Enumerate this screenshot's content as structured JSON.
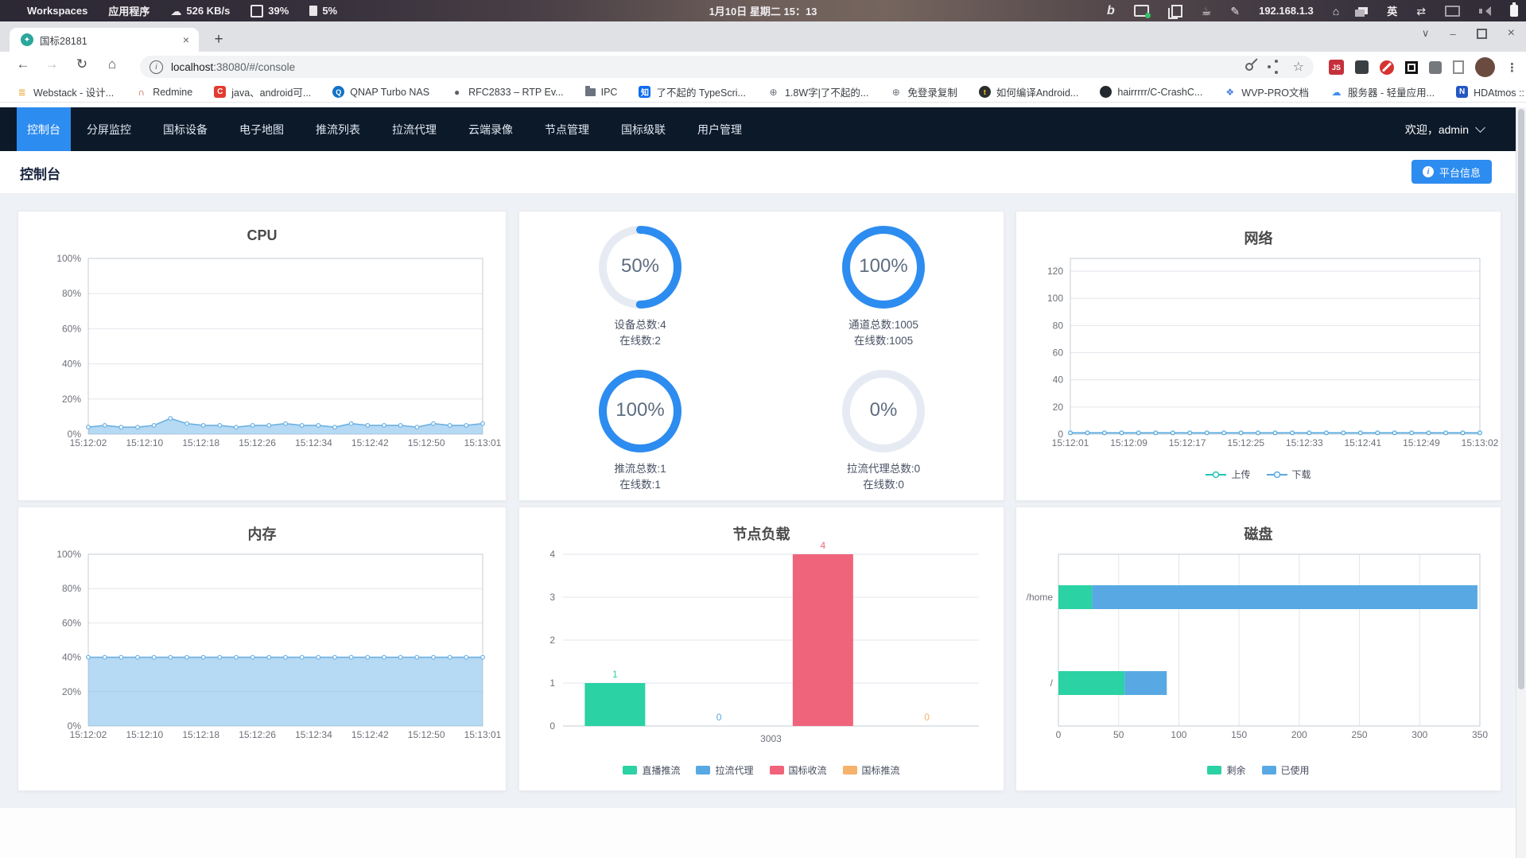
{
  "system_bar": {
    "workspaces": "Workspaces",
    "applications": "应用程序",
    "network_speed": "526 KB/s",
    "cpu": "39%",
    "memory": "5%",
    "clock": "1月10日 星期二 15：13",
    "ip": "192.168.1.3",
    "language": "英",
    "bing": "b"
  },
  "browser": {
    "tab_title": "国标28181",
    "url_host": "localhost",
    "url_path": ":38080/#/console",
    "js_badge": "JS"
  },
  "bookmarks": [
    {
      "label": "Webstack - 设计...",
      "icon": "webstack-icon",
      "style": "plain",
      "glyph": "≣",
      "color": "#e8a838"
    },
    {
      "label": "Redmine",
      "icon": "redmine-icon",
      "style": "plain",
      "glyph": "∩",
      "color": "#c7402f"
    },
    {
      "label": "java、android可...",
      "icon": "csdn-icon",
      "style": "badge",
      "glyph": "C",
      "color": "#ffffff",
      "bg": "#e23c32"
    },
    {
      "label": "QNAP Turbo NAS",
      "icon": "qnap-icon",
      "style": "circle",
      "glyph": "Q",
      "color": "#ffffff",
      "bg": "#1272c8"
    },
    {
      "label": "RFC2833 – RTP Ev...",
      "icon": "rfc-icon",
      "style": "plain",
      "glyph": "●",
      "color": "#5b5f66"
    },
    {
      "label": "IPC",
      "icon": "folder-icon",
      "style": "folder"
    },
    {
      "label": "了不起的 TypeScri...",
      "icon": "zhihu-icon",
      "style": "badge",
      "glyph": "知",
      "color": "#ffffff",
      "bg": "#0c6cf2"
    },
    {
      "label": "1.8W字|了不起的...",
      "icon": "globe-icon",
      "style": "plain",
      "glyph": "⊕",
      "color": "#6a6f77"
    },
    {
      "label": "免登录复制",
      "icon": "globe-icon",
      "style": "plain",
      "glyph": "⊕",
      "color": "#6a6f77"
    },
    {
      "label": "如何编译Android...",
      "icon": "penguin-icon",
      "style": "circle",
      "glyph": "t",
      "color": "#f4c20d",
      "bg": "#2b2d30"
    },
    {
      "label": "hairrrrr/C-CrashC...",
      "icon": "github-icon",
      "style": "circle",
      "glyph": "",
      "color": "#ffffff",
      "bg": "#24292f"
    },
    {
      "label": "WVP-PRO文档",
      "icon": "wvp-icon",
      "style": "plain",
      "glyph": "❖",
      "color": "#4a7fe0"
    },
    {
      "label": "服务器 - 轻量应用...",
      "icon": "cloud-icon",
      "style": "plain",
      "glyph": "☁",
      "color": "#3f8cf3"
    },
    {
      "label": "HDAtmos :: 种子 *...",
      "icon": "hdatmos-icon",
      "style": "badge",
      "glyph": "N",
      "color": "#ffffff",
      "bg": "#2456c4"
    }
  ],
  "bookmarks_overflow": "»",
  "navbar": {
    "items": [
      "控制台",
      "分屏监控",
      "国标设备",
      "电子地图",
      "推流列表",
      "拉流代理",
      "云端录像",
      "节点管理",
      "国标级联",
      "用户管理"
    ],
    "active_index": 0,
    "welcome": "欢迎，admin"
  },
  "page_header": {
    "title": "控制台",
    "platform_info_button": "平台信息"
  },
  "colors": {
    "accent_blue": "#2d8cf0",
    "gauge_track": "#e6ebf3",
    "teal": "#2bd2a4",
    "series_blue": "#58a9e3",
    "red": "#f0647b",
    "orange": "#f6b26b",
    "navbar_bg": "#0c1929"
  },
  "gauges": [
    {
      "percent": "50%",
      "value": 50,
      "line1": "设备总数:4",
      "line2": "在线数:2"
    },
    {
      "percent": "100%",
      "value": 100,
      "line1": "通道总数:1005",
      "line2": "在线数:1005"
    },
    {
      "percent": "100%",
      "value": 100,
      "line1": "推流总数:1",
      "line2": "在线数:1"
    },
    {
      "percent": "0%",
      "value": 0,
      "line1": "拉流代理总数:0",
      "line2": "在线数:0"
    }
  ],
  "chart_data": {
    "cpu": {
      "type": "area",
      "title": "CPU",
      "y_ticks": [
        "100%",
        "80%",
        "60%",
        "40%",
        "20%",
        "0%"
      ],
      "y_max": 100,
      "x_labels": [
        "15:12:02",
        "15:12:10",
        "15:12:18",
        "15:12:26",
        "15:12:34",
        "15:12:42",
        "15:12:50",
        "15:13:01"
      ],
      "series": [
        {
          "name": "cpu",
          "color": "#6cb1e1",
          "fill": "rgba(122,186,235,0.55)",
          "values": [
            4,
            5,
            4,
            4,
            5,
            9,
            6,
            5,
            5,
            4,
            5,
            5,
            6,
            5,
            5,
            4,
            6,
            5,
            5,
            5,
            4,
            6,
            5,
            5,
            6
          ]
        }
      ]
    },
    "memory": {
      "type": "area",
      "title": "内存",
      "y_ticks": [
        "100%",
        "80%",
        "60%",
        "40%",
        "20%",
        "0%"
      ],
      "y_max": 100,
      "x_labels": [
        "15:12:02",
        "15:12:10",
        "15:12:18",
        "15:12:26",
        "15:12:34",
        "15:12:42",
        "15:12:50",
        "15:13:01"
      ],
      "series": [
        {
          "name": "memory",
          "color": "#6cb1e1",
          "fill": "rgba(122,186,235,0.55)",
          "values": [
            40,
            40,
            40,
            40,
            40,
            40,
            40,
            40,
            40,
            40,
            40,
            40,
            40,
            40,
            40,
            40,
            40,
            40,
            40,
            40,
            40,
            40,
            40,
            40,
            40
          ]
        }
      ]
    },
    "network": {
      "type": "line",
      "title": "网络",
      "y_ticks": [
        "120",
        "100",
        "80",
        "60",
        "40",
        "20",
        "0"
      ],
      "y_max": 120,
      "x_labels": [
        "15:12:01",
        "15:12:09",
        "15:12:17",
        "15:12:25",
        "15:12:33",
        "15:12:41",
        "15:12:49",
        "15:13:02"
      ],
      "legend": [
        "上传",
        "下载"
      ],
      "series": [
        {
          "name": "上传",
          "color": "#22c5b6",
          "values": [
            1,
            1,
            1,
            1,
            1,
            1,
            1,
            1,
            1,
            1,
            1,
            1,
            1,
            1,
            1,
            1,
            1,
            1,
            1,
            1,
            1,
            1,
            1,
            1,
            1
          ]
        },
        {
          "name": "下载",
          "color": "#58a9e3",
          "values": [
            1,
            1,
            1,
            1,
            1,
            1,
            1,
            1,
            1,
            1,
            1,
            1,
            1,
            1,
            1,
            1,
            1,
            1,
            1,
            1,
            1,
            1,
            1,
            1,
            1
          ]
        }
      ]
    },
    "node_load": {
      "type": "bar",
      "title": "节点负载",
      "y_ticks": [
        4,
        3,
        2,
        1,
        0
      ],
      "y_max": 4,
      "categories": [
        "直播推流",
        "拉流代理",
        "国标收流",
        "国标推流"
      ],
      "values": [
        1,
        0,
        4,
        0
      ],
      "colors": [
        "#2bd2a4",
        "#58a9e3",
        "#f0647b",
        "#f6b26b"
      ],
      "x_label": "3003"
    },
    "disk": {
      "type": "hbar-stacked",
      "title": "磁盘",
      "categories": [
        "/home",
        "/"
      ],
      "x_ticks": [
        0,
        50,
        100,
        150,
        200,
        250,
        300,
        350
      ],
      "x_max": 350,
      "series": [
        {
          "name": "剩余",
          "color": "#2bd2a4",
          "values": [
            28,
            55
          ]
        },
        {
          "name": "已使用",
          "color": "#58a9e3",
          "values": [
            320,
            35
          ]
        }
      ]
    }
  }
}
